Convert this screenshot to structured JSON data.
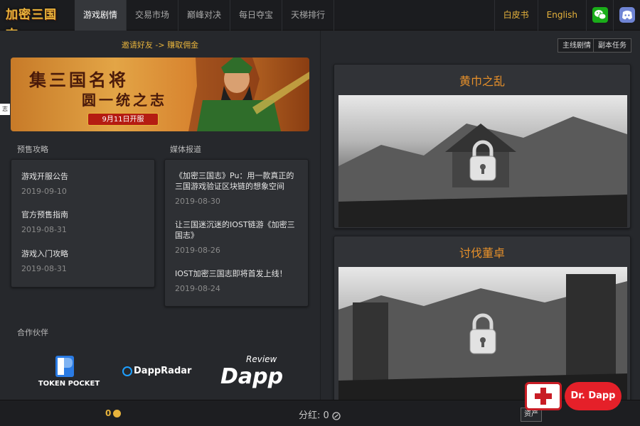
{
  "header": {
    "logo_text": "加密三国志",
    "nav": [
      {
        "label": "游戏剧情",
        "active": true
      },
      {
        "label": "交易市场",
        "active": false
      },
      {
        "label": "巅峰对决",
        "active": false
      },
      {
        "label": "每日夺宝",
        "active": false
      },
      {
        "label": "天梯排行",
        "active": false
      }
    ],
    "whitepaper": "白皮书",
    "language": "English",
    "social": [
      "wechat-icon",
      "discord-icon"
    ]
  },
  "left": {
    "invite_text": "邀请好友 -> 赚取佣金",
    "banner": {
      "title": "集三国名将",
      "subtitle": "圆一统之志",
      "date": "9月11日开服"
    },
    "side_tab": "志",
    "presale": {
      "title": "预售攻略",
      "items": [
        {
          "title": "游戏开服公告",
          "date": "2019-09-10"
        },
        {
          "title": "官方预售指南",
          "date": "2019-08-31"
        },
        {
          "title": "游戏入门攻略",
          "date": "2019-08-31"
        }
      ]
    },
    "media": {
      "title": "媒体报道",
      "items": [
        {
          "title": "《加密三国志》Pu：用一款真正的三国游戏验证区块链的想象空间",
          "date": "2019-08-30"
        },
        {
          "title": "让三国迷沉迷的IOST链游《加密三国志》",
          "date": "2019-08-26"
        },
        {
          "title": "IOST加密三国志即将首发上线！",
          "date": "2019-08-24"
        }
      ]
    },
    "partners": {
      "title": "合作伙伴",
      "tokenpocket": "TOKEN POCKET",
      "dappradar": "DappRadar",
      "dapp_review_small": "Review",
      "dapp_review_big": "Dapp"
    }
  },
  "right": {
    "tabs": [
      "主线剧情",
      "副本任务"
    ],
    "chapters": [
      {
        "title": "黄巾之乱",
        "locked": true
      },
      {
        "title": "讨伐董卓",
        "locked": true
      }
    ]
  },
  "bottom": {
    "gold": "0",
    "dividend_label": "分红:",
    "dividend_value": "0",
    "asset_button": "资产"
  },
  "watermark": {
    "text": "Dr. Dapp"
  },
  "colors": {
    "accent": "#e7b33c",
    "chapter_title": "#e7902a",
    "active_nav": "#35373b"
  }
}
